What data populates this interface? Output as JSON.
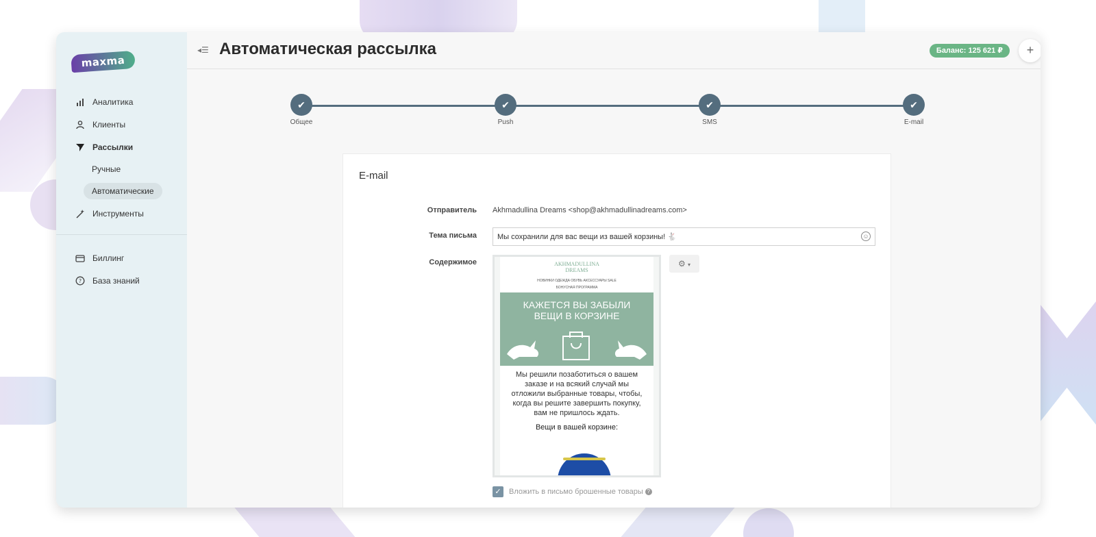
{
  "app": {
    "logo_text": "maxma",
    "page_title": "Автоматическая рассылка",
    "balance": "Баланс: 125 621 ₽"
  },
  "sidebar": {
    "items": [
      {
        "label": "Аналитика",
        "icon": "bar-chart-icon"
      },
      {
        "label": "Клиенты",
        "icon": "user-icon"
      },
      {
        "label": "Рассылки",
        "icon": "send-icon"
      }
    ],
    "sub_items": [
      {
        "label": "Ручные",
        "active": false
      },
      {
        "label": "Автоматические",
        "active": true
      }
    ],
    "tools": {
      "label": "Инструменты",
      "icon": "magic-wand-icon"
    },
    "bottom_items": [
      {
        "label": "Биллинг",
        "icon": "credit-card-icon"
      },
      {
        "label": "База знаний",
        "icon": "help-circle-icon"
      }
    ]
  },
  "stepper": {
    "steps": [
      {
        "label": "Общее",
        "done": true
      },
      {
        "label": "Push",
        "done": true
      },
      {
        "label": "SMS",
        "done": true
      },
      {
        "label": "E-mail",
        "done": true
      }
    ]
  },
  "email_form": {
    "section_title": "E-mail",
    "sender_label": "Отправитель",
    "sender_value": "Akhmadullina Dreams <shop@akhmadullinadreams.com>",
    "subject_label": "Тема письма",
    "subject_value": "Мы сохранили для вас вещи из вашей корзины! 🐇",
    "content_label": "Содержимое",
    "attach_label": "Вложить в письмо брошенные товары",
    "attach_checked": true
  },
  "preview": {
    "brand_line1": "AKHMADULLINA",
    "brand_line2": "DREAMS",
    "nav_line1": "НОВИНКИ   ОДЕЖДА   ОБУВЬ   АКСЕССУАРЫ   SALE",
    "nav_line2": "БОНУСНАЯ ПРОГРАММА",
    "headline_line1": "КАЖЕТСЯ ВЫ ЗАБЫЛИ",
    "headline_line2": "ВЕЩИ В КОРЗИНЕ",
    "body_text": "Мы решили позаботиться о вашем заказе и на всякий случай мы отложили выбранные товары, чтобы, когда вы решите завершить покупку, вам не пришлось ждать.",
    "cart_title": "Вещи в вашей корзине:"
  },
  "colors": {
    "accent": "#546d7e",
    "balance_bg": "#6ab585",
    "sidebar_bg": "#e7f1f4",
    "banner_bg": "#8fb4a0"
  }
}
